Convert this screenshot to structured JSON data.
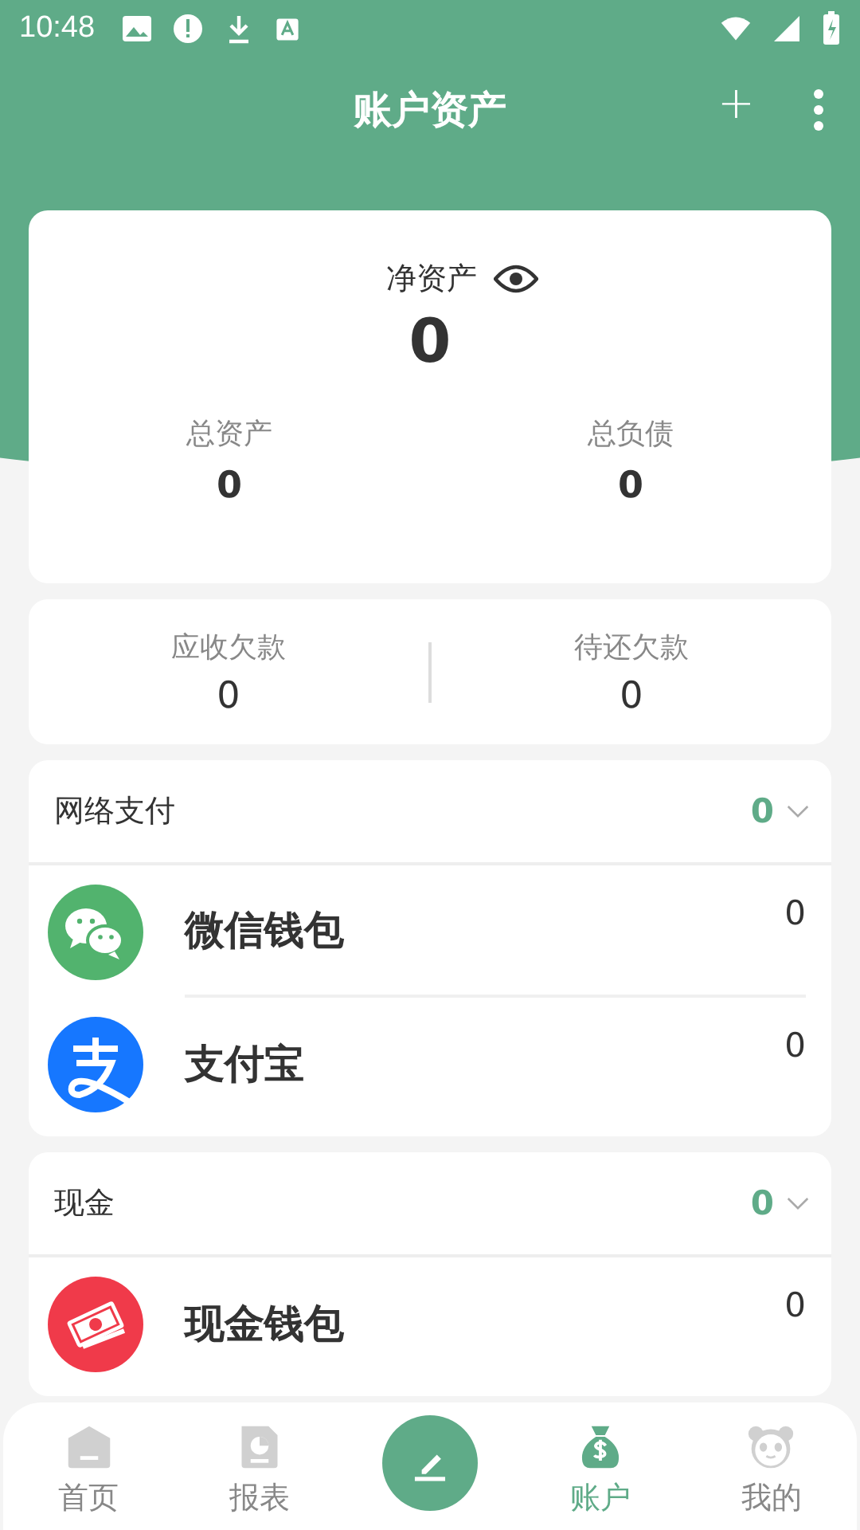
{
  "status_bar": {
    "time": "10:48"
  },
  "header": {
    "title": "账户资产",
    "add": "+"
  },
  "summary": {
    "label": "净资产",
    "value": "0",
    "stats": [
      {
        "label": "总资产",
        "value": "0"
      },
      {
        "label": "总负债",
        "value": "0"
      }
    ]
  },
  "debts": [
    {
      "label": "应收欠款",
      "value": "0"
    },
    {
      "label": "待还欠款",
      "value": "0"
    }
  ],
  "groups": [
    {
      "title": "网络支付",
      "total": "0",
      "accounts": [
        {
          "name": "微信钱包",
          "balance": "0",
          "color": "#52b36e"
        },
        {
          "name": "支付宝",
          "balance": "0",
          "color": "#1677ff"
        }
      ]
    },
    {
      "title": "现金",
      "total": "0",
      "accounts": [
        {
          "name": "现金钱包",
          "balance": "0",
          "color": "#f03a4a"
        }
      ]
    }
  ],
  "nav": [
    {
      "kind": "tab",
      "label": "首页",
      "selected": false
    },
    {
      "kind": "tab",
      "label": "报表",
      "selected": false
    },
    {
      "kind": "action"
    },
    {
      "kind": "tab",
      "label": "账户",
      "selected": true
    },
    {
      "kind": "tab",
      "label": "我的",
      "selected": false
    }
  ]
}
